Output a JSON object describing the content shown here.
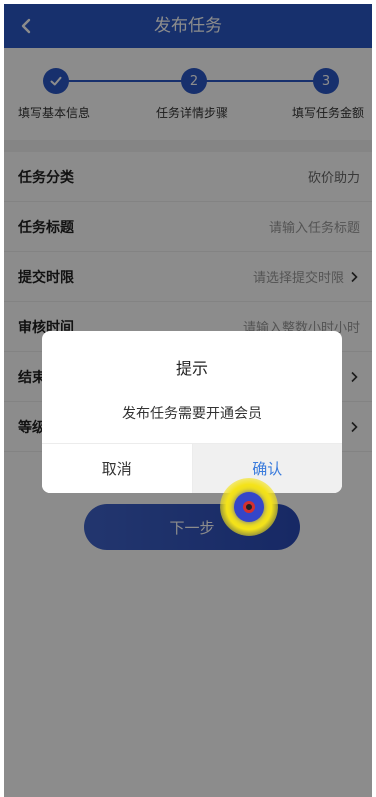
{
  "header": {
    "title": "发布任务"
  },
  "stepper": {
    "steps": [
      {
        "label": "填写基本信息",
        "number": "1"
      },
      {
        "label": "任务详情步骤",
        "number": "2"
      },
      {
        "label": "填写任务金额",
        "number": "3"
      }
    ]
  },
  "form": {
    "rows": [
      {
        "label": "任务分类",
        "value": "砍价助力"
      },
      {
        "label": "任务标题",
        "value": "请输入任务标题"
      },
      {
        "label": "提交时限",
        "value": "请选择提交时限"
      },
      {
        "label": "审核时间",
        "value": "请输入整数小时小时"
      },
      {
        "label": "结束",
        "value": ""
      },
      {
        "label": "等级",
        "value": ""
      }
    ],
    "next_label": "下一步"
  },
  "dialog": {
    "title": "提示",
    "message": "发布任务需要开通会员",
    "cancel_label": "取消",
    "confirm_label": "确认"
  },
  "colors": {
    "primary": "#2b58c6",
    "confirm_text": "#3a7bdc"
  }
}
